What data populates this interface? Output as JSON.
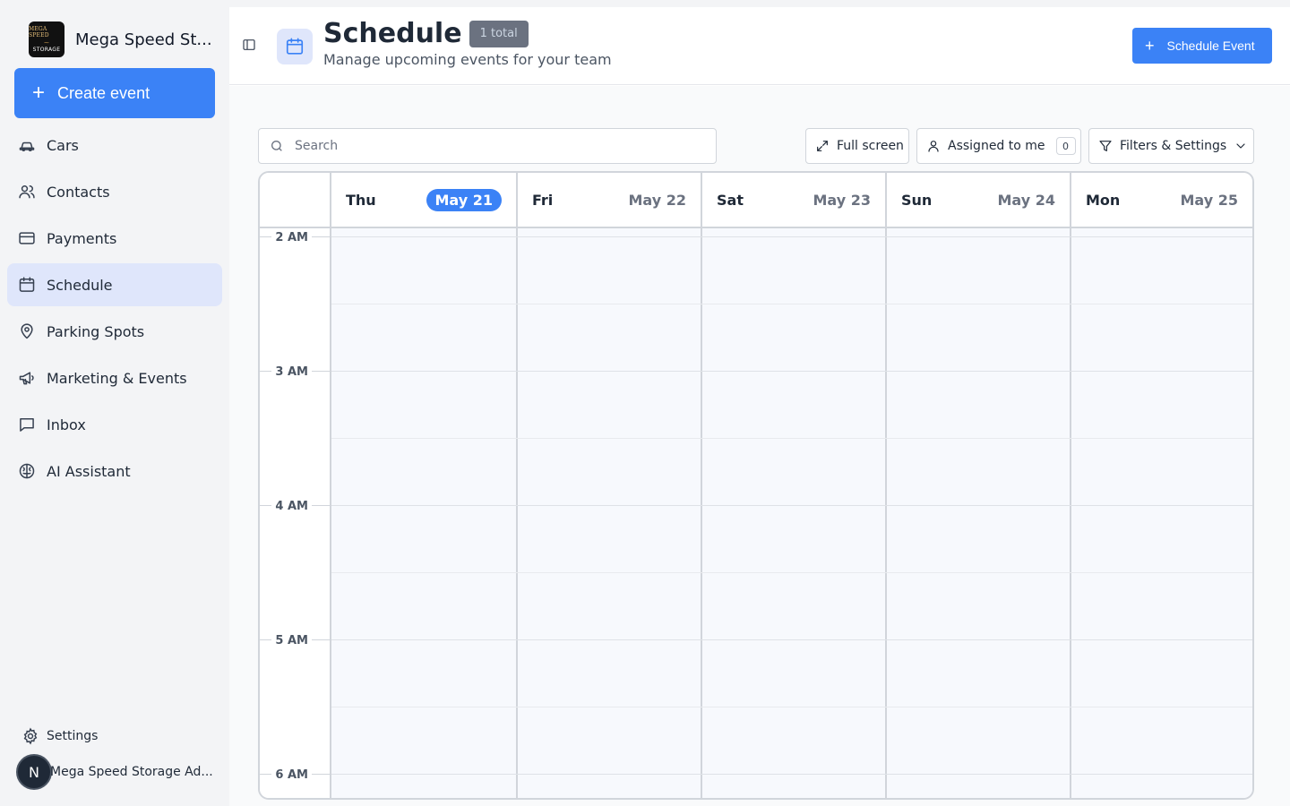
{
  "sidebar": {
    "org_name": "Mega Speed St...",
    "logo": {
      "line1": "MEGA SPEED",
      "line2": "~",
      "line3": "STORAGE"
    },
    "create_label": "Create event",
    "items": [
      {
        "label": "Cars",
        "icon": "car-icon"
      },
      {
        "label": "Contacts",
        "icon": "users-icon"
      },
      {
        "label": "Payments",
        "icon": "credit-card-icon"
      },
      {
        "label": "Schedule",
        "icon": "calendar-icon",
        "active": true
      },
      {
        "label": "Parking Spots",
        "icon": "map-pin-icon"
      },
      {
        "label": "Marketing & Events",
        "icon": "megaphone-icon"
      },
      {
        "label": "Inbox",
        "icon": "message-square-icon"
      },
      {
        "label": "AI Assistant",
        "icon": "brain-icon"
      }
    ],
    "settings_label": "Settings",
    "user": {
      "initial": "N",
      "name": "Mega Speed Storage Ad..."
    }
  },
  "header": {
    "title": "Schedule",
    "badge": "1 total",
    "subtitle": "Manage upcoming events for your team",
    "schedule_btn": "Schedule Event"
  },
  "toolbar": {
    "search_placeholder": "Search",
    "fullscreen_label": "Full screen",
    "assigned_label": "Assigned to me",
    "assigned_count": "0",
    "filters_label": "Filters & Settings"
  },
  "calendar": {
    "days": [
      {
        "name": "Thu",
        "date": "May 21",
        "today": true
      },
      {
        "name": "Fri",
        "date": "May 22"
      },
      {
        "name": "Sat",
        "date": "May 23"
      },
      {
        "name": "Sun",
        "date": "May 24"
      },
      {
        "name": "Mon",
        "date": "May 25"
      }
    ],
    "times": [
      "2 AM",
      "3 AM",
      "4 AM",
      "5 AM",
      "6 AM"
    ]
  },
  "colors": {
    "accent": "#3b82f6",
    "active_nav": "#dfe6fb",
    "badge": "#6b7280"
  }
}
